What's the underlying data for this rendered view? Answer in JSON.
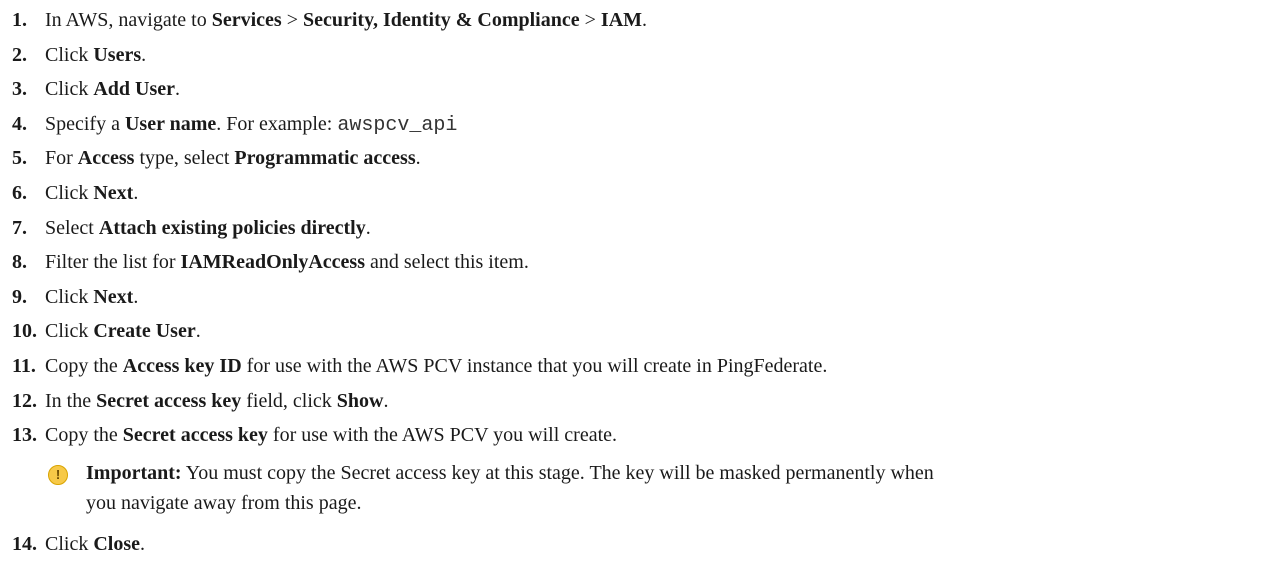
{
  "steps": [
    {
      "num": "1.",
      "parts": [
        {
          "t": "In AWS, navigate to "
        },
        {
          "t": "Services",
          "b": true
        },
        {
          "t": " > "
        },
        {
          "t": "Security, Identity & Compliance",
          "b": true
        },
        {
          "t": " > "
        },
        {
          "t": "IAM",
          "b": true
        },
        {
          "t": "."
        }
      ]
    },
    {
      "num": "2.",
      "parts": [
        {
          "t": "Click "
        },
        {
          "t": "Users",
          "b": true
        },
        {
          "t": "."
        }
      ]
    },
    {
      "num": "3.",
      "parts": [
        {
          "t": "Click "
        },
        {
          "t": "Add User",
          "b": true
        },
        {
          "t": "."
        }
      ]
    },
    {
      "num": "4.",
      "parts": [
        {
          "t": "Specify a "
        },
        {
          "t": "User name",
          "b": true
        },
        {
          "t": ". For example: "
        },
        {
          "t": "awspcv_api",
          "m": true
        }
      ]
    },
    {
      "num": "5.",
      "parts": [
        {
          "t": "For "
        },
        {
          "t": "Access",
          "b": true
        },
        {
          "t": " type, select "
        },
        {
          "t": "Programmatic access",
          "b": true
        },
        {
          "t": "."
        }
      ]
    },
    {
      "num": "6.",
      "parts": [
        {
          "t": "Click "
        },
        {
          "t": "Next",
          "b": true
        },
        {
          "t": "."
        }
      ]
    },
    {
      "num": "7.",
      "parts": [
        {
          "t": "Select "
        },
        {
          "t": "Attach existing policies directly",
          "b": true
        },
        {
          "t": "."
        }
      ]
    },
    {
      "num": "8.",
      "parts": [
        {
          "t": "Filter the list for "
        },
        {
          "t": "IAMReadOnlyAccess",
          "b": true
        },
        {
          "t": " and select this item."
        }
      ]
    },
    {
      "num": "9.",
      "parts": [
        {
          "t": "Click "
        },
        {
          "t": "Next",
          "b": true
        },
        {
          "t": "."
        }
      ]
    },
    {
      "num": "10.",
      "parts": [
        {
          "t": "Click "
        },
        {
          "t": "Create User",
          "b": true
        },
        {
          "t": "."
        }
      ]
    },
    {
      "num": "11.",
      "parts": [
        {
          "t": "Copy the "
        },
        {
          "t": "Access key ID",
          "b": true
        },
        {
          "t": " for use with the AWS PCV instance that you will create in PingFederate."
        }
      ]
    },
    {
      "num": "12.",
      "parts": [
        {
          "t": "In the "
        },
        {
          "t": "Secret access key",
          "b": true
        },
        {
          "t": " field, click "
        },
        {
          "t": "Show",
          "b": true
        },
        {
          "t": "."
        }
      ]
    },
    {
      "num": "13.",
      "parts": [
        {
          "t": "Copy the "
        },
        {
          "t": "Secret access key",
          "b": true
        },
        {
          "t": " for use with the AWS PCV you will create."
        }
      ]
    }
  ],
  "note": {
    "icon": "warning-icon",
    "label": "Important:",
    "line1": " You must copy the Secret access key at this stage. The key will be masked permanently when",
    "line2": "you navigate away from this page."
  },
  "last_step": {
    "num": "14.",
    "parts": [
      {
        "t": "Click "
      },
      {
        "t": "Close",
        "b": true
      },
      {
        "t": "."
      }
    ]
  }
}
